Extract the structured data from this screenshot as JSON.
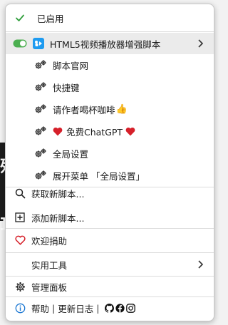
{
  "menu": {
    "enabled_label": "已启用",
    "script": {
      "name": "HTML5视频播放器增强脚本",
      "commands": [
        {
          "label": "脚本官网"
        },
        {
          "label": "快捷键"
        },
        {
          "label": "请作者喝杯咖啡"
        },
        {
          "label": "免费ChatGPT"
        },
        {
          "label": "全局设置"
        },
        {
          "label": "展开菜单 「全局设置」"
        }
      ]
    },
    "get_new_label": "获取新脚本...",
    "add_new_label": "添加新脚本...",
    "donate_label": "欢迎捐助",
    "utilities_label": "实用工具",
    "dashboard_label": "管理面板",
    "footer": {
      "help_label": "帮助",
      "separator": "|",
      "changelog_label": "更新日志"
    }
  },
  "colors": {
    "accent_green": "#2e9e3a",
    "toggle_green": "#4caf50",
    "heart_red": "#d6202a",
    "script_icon_blue": "#1e9bf0",
    "info_blue": "#1976d2",
    "hover_gray": "#ebebeb"
  },
  "icons": {
    "enabled": "check-icon",
    "toggle": "toggle-switch-icon",
    "script": "script-icon",
    "command": "gear-icon",
    "search": "search-icon",
    "add": "plus-square-icon",
    "donate": "heart-icon",
    "chevron": "chevron-right-icon",
    "dashboard": "gear-icon",
    "info": "info-icon",
    "github": "github-icon",
    "facebook": "facebook-icon",
    "instagram": "instagram-icon"
  }
}
